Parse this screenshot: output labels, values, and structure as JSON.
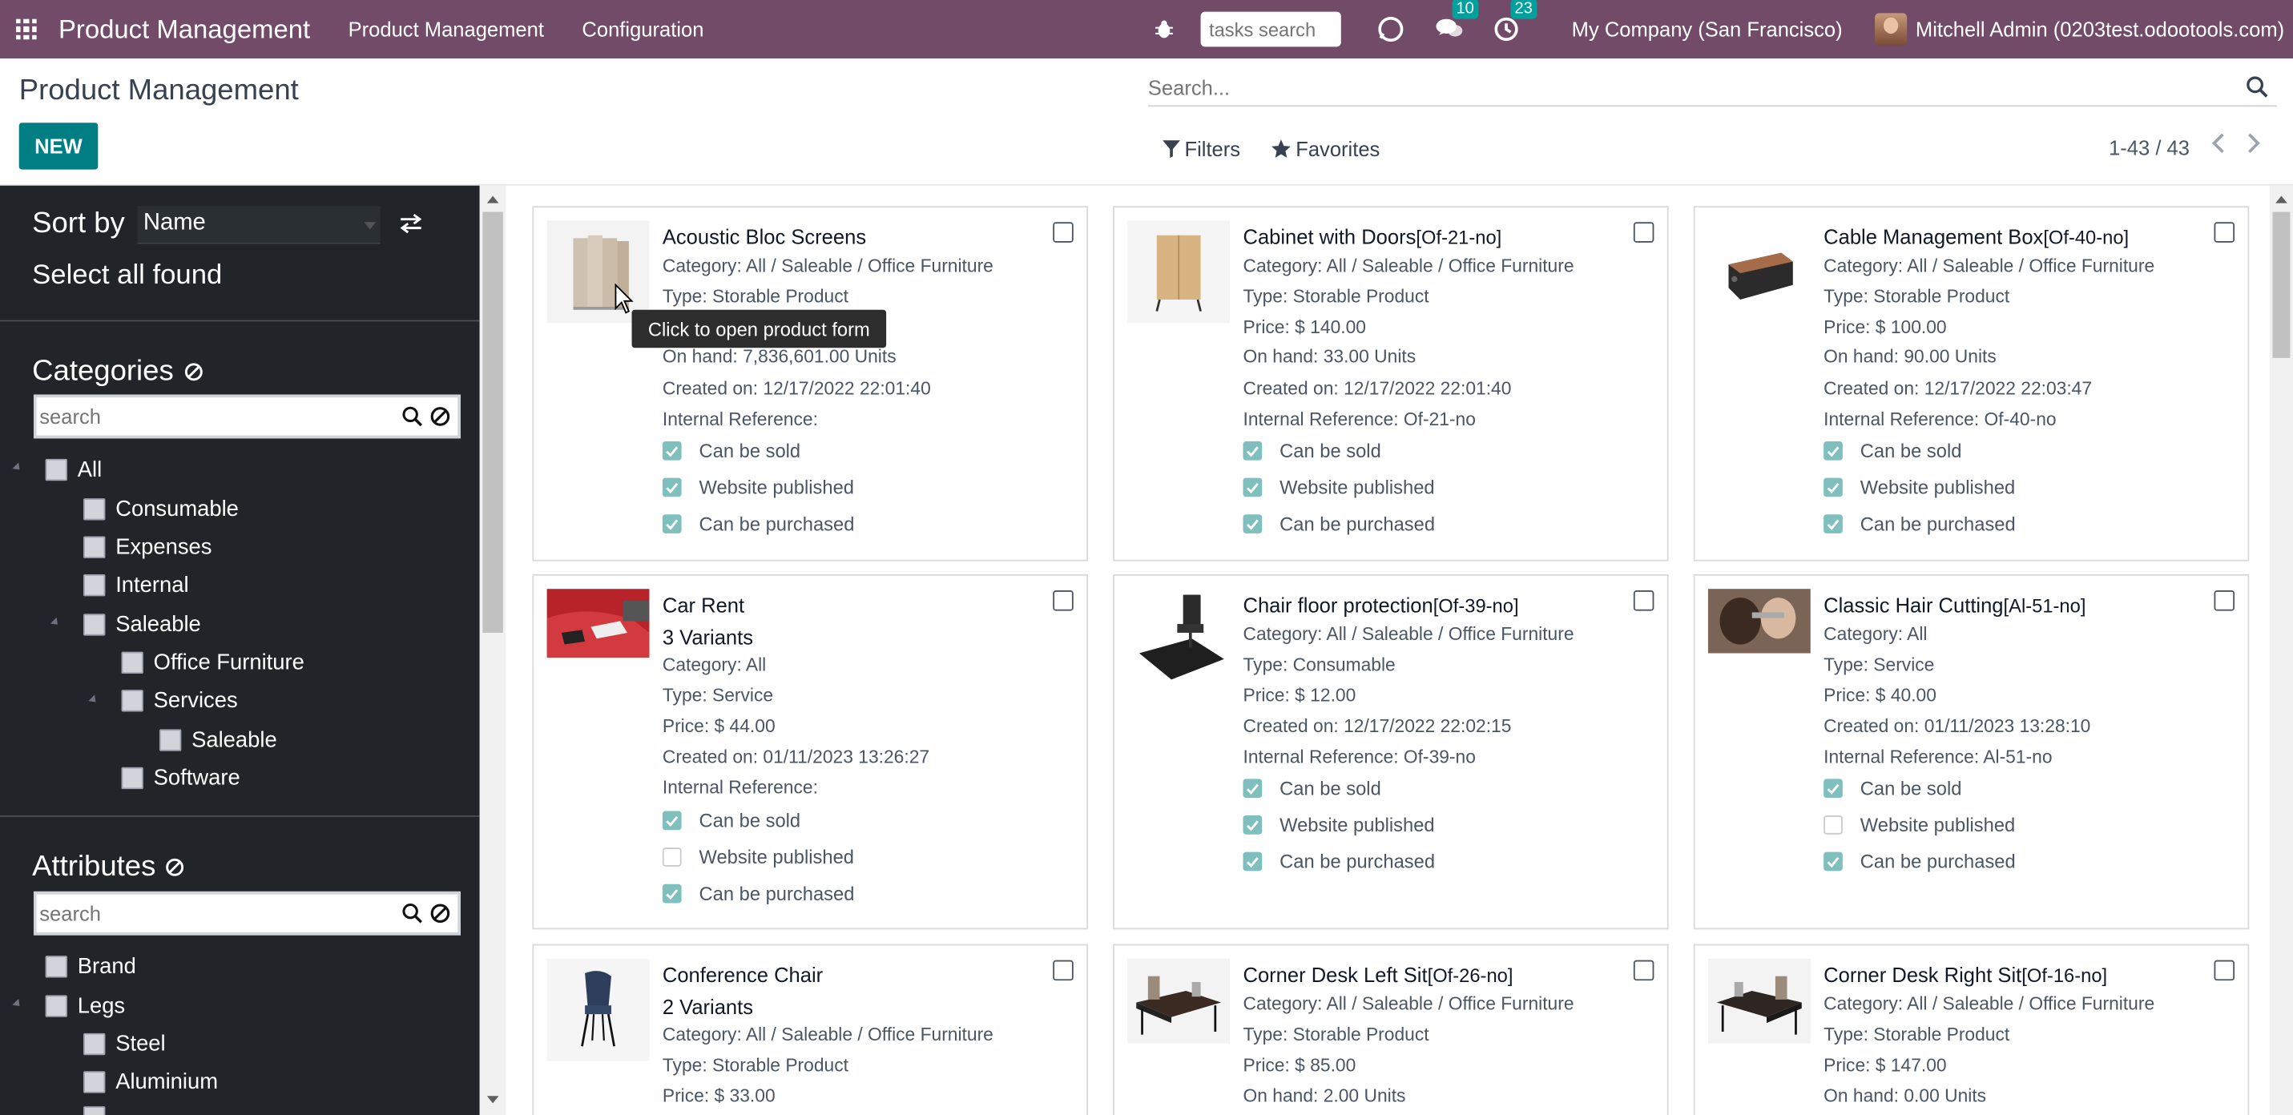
{
  "navbar": {
    "brand": "Product Management",
    "menu": [
      "Product Management",
      "Configuration"
    ],
    "tasks_search_placeholder": "tasks search",
    "messages_count": "10",
    "activities_count": "23",
    "company": "My Company (San Francisco)",
    "user": "Mitchell Admin (0203test.odootools.com)",
    "accent_color": "#714b67"
  },
  "control_panel": {
    "title": "Product Management",
    "new_label": "NEW",
    "search_placeholder": "Search...",
    "filters_label": "Filters",
    "favorites_label": "Favorites",
    "pager": "1-43 / 43"
  },
  "sidebar": {
    "sort_label": "Sort by",
    "sort_value": "Name",
    "select_all": "Select all found",
    "categories_title": "Categories",
    "categories_search_placeholder": "search",
    "categories": [
      "All",
      "Consumable",
      "Expenses",
      "Internal",
      "Saleable",
      "Office Furniture",
      "Services",
      "Saleable",
      "Software"
    ],
    "attributes_title": "Attributes",
    "attributes_search_placeholder": "search",
    "attributes": [
      "Brand",
      "Legs",
      "Steel",
      "Aluminium"
    ]
  },
  "tooltip": "Click to open product form",
  "products": [
    {
      "name": "Acoustic Bloc Screens",
      "ref": "",
      "lines": [
        "Category: All / Saleable / Office Furniture",
        "Type: Storable Product",
        "On hand: 7,836,601.00 Units",
        "Created on: 12/17/2022 22:01:40",
        "Internal Reference:"
      ],
      "checks": [
        {
          "label": "Can be sold",
          "on": true
        },
        {
          "label": "Website published",
          "on": true
        },
        {
          "label": "Can be purchased",
          "on": true
        }
      ]
    },
    {
      "name": "Cabinet with Doors",
      "ref": "[Of-21-no]",
      "lines": [
        "Category: All / Saleable / Office Furniture",
        "Type: Storable Product",
        "Price: $ 140.00",
        "On hand: 33.00 Units",
        "Created on: 12/17/2022 22:01:40",
        "Internal Reference: Of-21-no"
      ],
      "checks": [
        {
          "label": "Can be sold",
          "on": true
        },
        {
          "label": "Website published",
          "on": true
        },
        {
          "label": "Can be purchased",
          "on": true
        }
      ]
    },
    {
      "name": "Cable Management Box",
      "ref": "[Of-40-no]",
      "lines": [
        "Category: All / Saleable / Office Furniture",
        "Type: Storable Product",
        "Price: $ 100.00",
        "On hand: 90.00 Units",
        "Created on: 12/17/2022 22:03:47",
        "Internal Reference: Of-40-no"
      ],
      "checks": [
        {
          "label": "Can be sold",
          "on": true
        },
        {
          "label": "Website published",
          "on": true
        },
        {
          "label": "Can be purchased",
          "on": true
        }
      ]
    },
    {
      "name": "Car Rent",
      "ref": "",
      "variants": "3 Variants",
      "lines": [
        "Category: All",
        "Type: Service",
        "Price: $ 44.00",
        "Created on: 01/11/2023 13:26:27",
        "Internal Reference:"
      ],
      "checks": [
        {
          "label": "Can be sold",
          "on": true
        },
        {
          "label": "Website published",
          "on": false
        },
        {
          "label": "Can be purchased",
          "on": true
        }
      ]
    },
    {
      "name": "Chair floor protection",
      "ref": "[Of-39-no]",
      "lines": [
        "Category: All / Saleable / Office Furniture",
        "Type: Consumable",
        "Price: $ 12.00",
        "Created on: 12/17/2022 22:02:15",
        "Internal Reference: Of-39-no"
      ],
      "checks": [
        {
          "label": "Can be sold",
          "on": true
        },
        {
          "label": "Website published",
          "on": true
        },
        {
          "label": "Can be purchased",
          "on": true
        }
      ]
    },
    {
      "name": "Classic Hair Cutting",
      "ref": "[Al-51-no]",
      "lines": [
        "Category: All",
        "Type: Service",
        "Price: $ 40.00",
        "Created on: 01/11/2023 13:28:10",
        "Internal Reference: Al-51-no"
      ],
      "checks": [
        {
          "label": "Can be sold",
          "on": true
        },
        {
          "label": "Website published",
          "on": false
        },
        {
          "label": "Can be purchased",
          "on": true
        }
      ]
    },
    {
      "name": "Conference Chair",
      "ref": "",
      "variants": "2 Variants",
      "lines": [
        "Category: All / Saleable / Office Furniture",
        "Type: Storable Product",
        "Price: $ 33.00"
      ],
      "checks": []
    },
    {
      "name": "Corner Desk Left Sit",
      "ref": "[Of-26-no]",
      "lines": [
        "Category: All / Saleable / Office Furniture",
        "Type: Storable Product",
        "Price: $ 85.00",
        "On hand: 2.00 Units"
      ],
      "checks": []
    },
    {
      "name": "Corner Desk Right Sit",
      "ref": "[Of-16-no]",
      "lines": [
        "Category: All / Saleable / Office Furniture",
        "Type: Storable Product",
        "Price: $ 147.00",
        "On hand: 0.00 Units"
      ],
      "checks": []
    }
  ]
}
